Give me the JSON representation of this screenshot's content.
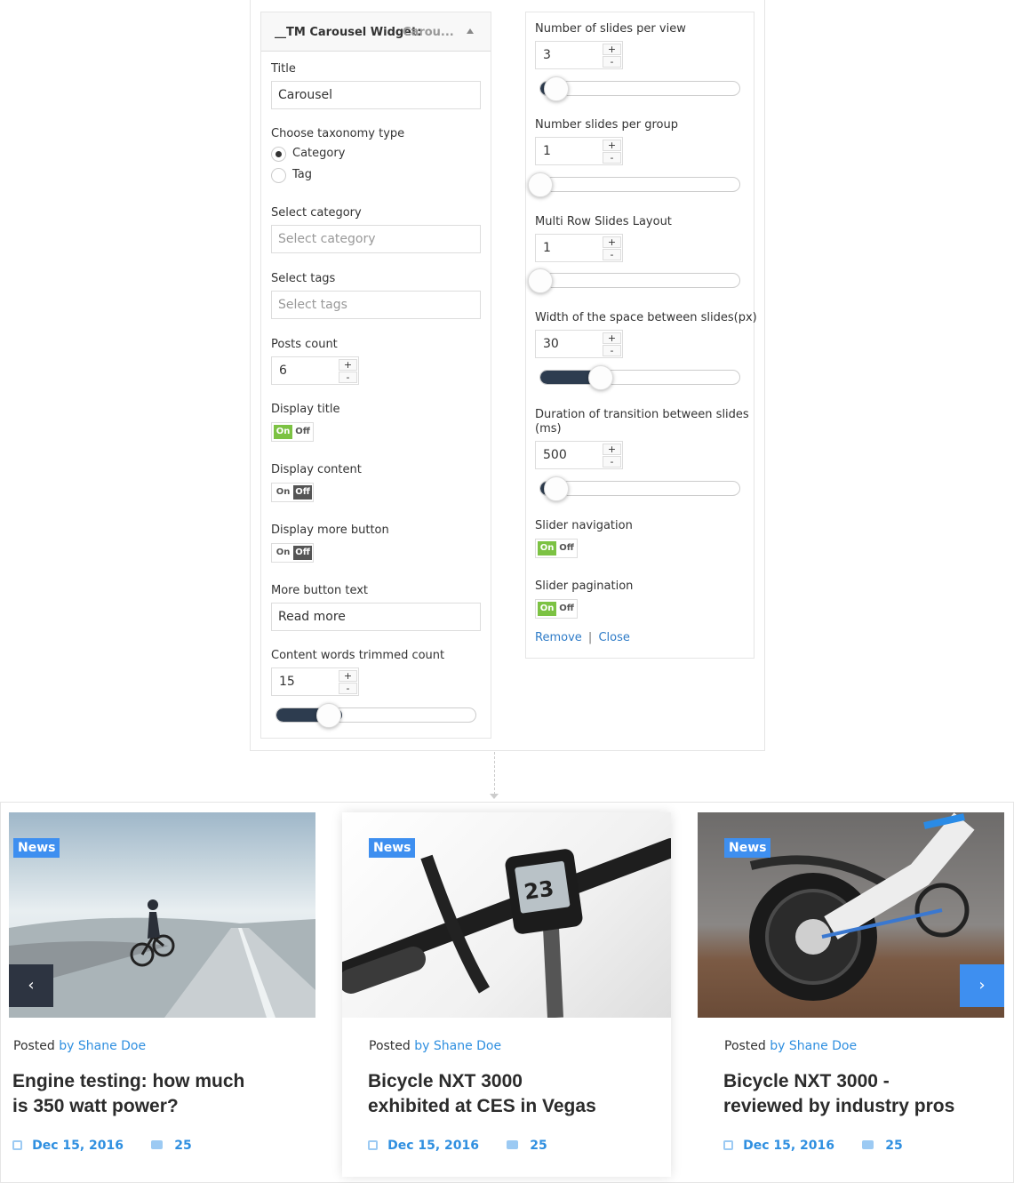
{
  "widget": {
    "header_title": "__TM Carousel Widget:",
    "header_sub": "Carou...",
    "title_label": "Title",
    "title_value": "Carousel",
    "taxonomy_label": "Choose taxonomy type",
    "taxonomy_options": [
      "Category",
      "Tag"
    ],
    "taxonomy_selected": "Category",
    "category_label": "Select category",
    "category_placeholder": "Select category",
    "tags_label": "Select tags",
    "tags_placeholder": "Select tags",
    "posts_count_label": "Posts count",
    "posts_count_value": "6",
    "display_title_label": "Display title",
    "display_content_label": "Display content",
    "display_more_label": "Display more button",
    "more_text_label": "More button text",
    "more_text_value": "Read more",
    "trim_label": "Content words trimmed count",
    "trim_value": "15",
    "trim_level": 0.27,
    "toggle_on": "On",
    "toggle_off": "Off",
    "display_title_state": "On",
    "display_content_state": "Off",
    "display_more_state": "Off",
    "spin_plus": "+",
    "spin_minus": "-",
    "slides_view_label": "Number of slides per view",
    "slides_view_value": "3",
    "slides_view_level": 0.07,
    "slides_group_label": "Number slides per group",
    "slides_group_value": "1",
    "slides_group_level": 0,
    "multirow_label": "Multi Row Slides Layout",
    "multirow_value": "1",
    "multirow_level": 0,
    "space_label": "Width of the space between slides(px)",
    "space_value": "30",
    "space_level": 0.28,
    "duration_label_1": "Duration of transition between slides",
    "duration_label_2": "(ms)",
    "duration_value": "500",
    "duration_level": 0.07,
    "nav_label": "Slider navigation",
    "nav_state": "On",
    "pagination_label": "Slider pagination",
    "pagination_state": "On",
    "remove_link": "Remove",
    "separator": "|",
    "close_link": "Close"
  },
  "carousel": {
    "badge": "News",
    "posted": "Posted",
    "author": "by Shane Doe",
    "prev_icon": "‹",
    "next_icon": "›",
    "cards": [
      {
        "title_1": "Engine testing: how much",
        "title_2": "is 350 watt power?",
        "date": "Dec 15, 2016",
        "comments": "25"
      },
      {
        "title_1": "Bicycle NXT 3000",
        "title_2": "exhibited at CES in Vegas",
        "date": "Dec 15, 2016",
        "comments": "25"
      },
      {
        "title_1": "Bicycle NXT 3000 -",
        "title_2": "reviewed by industry pros",
        "date": "Dec 15, 2016",
        "comments": "25"
      }
    ]
  },
  "colors": {
    "accent": "#3e8ff0",
    "toggle_on": "#7cc243",
    "slider_fill": "#2d3c4f",
    "nav_dark": "#2d3441"
  }
}
